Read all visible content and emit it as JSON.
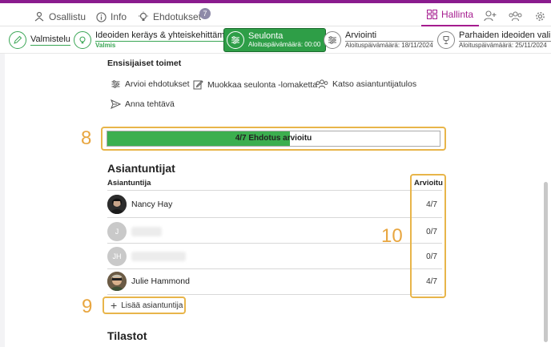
{
  "topnav": {
    "participation": "Osallistu",
    "info": "Info",
    "ideas": "Ehdotukset",
    "ideas_badge": "7",
    "admin": "Hallinta"
  },
  "phases": [
    {
      "title": "Valmistelu",
      "sub": ""
    },
    {
      "title": "Ideoiden keräys & yhteiskehittäminen",
      "sub": "Valmis"
    },
    {
      "title": "Seulonta",
      "sub": "Aloituspäivämäärä: 00:00"
    },
    {
      "title": "Arviointi",
      "sub": "Aloituspäivämäärä: 18/11/2024"
    },
    {
      "title": "Parhaiden ideoiden valinta",
      "sub": "Aloituspäivämäärä: 25/11/2024"
    }
  ],
  "priority": {
    "heading": "Ensisijaiset toimet",
    "actions": [
      "Arvioi ehdotukset",
      "Muokkaa seulonta -lomaketta",
      "Katso asiantuntijatulos",
      "Anna tehtävä"
    ]
  },
  "progress": {
    "label": "4/7 Ehdotus arvioitu",
    "fraction": 0.55
  },
  "callouts": {
    "c8": "8",
    "c9": "9",
    "c10": "10"
  },
  "experts": {
    "heading": "Asiantuntijat",
    "col_name": "Asiantuntija",
    "col_score": "Arvioitu",
    "rows": [
      {
        "initials": "",
        "name": "Nancy Hay",
        "score": "4/7"
      },
      {
        "initials": "J",
        "name": "",
        "score": "0/7"
      },
      {
        "initials": "JH",
        "name": "",
        "score": "0/7"
      },
      {
        "initials": "",
        "name": "Julie Hammond",
        "score": "4/7"
      }
    ],
    "add_label": "Lisää asiantuntija"
  },
  "stats": {
    "heading": "Tilastot"
  },
  "colors": {
    "accent": "#a51c8f",
    "green": "#2e9e47",
    "highlight": "#e8b54a"
  }
}
